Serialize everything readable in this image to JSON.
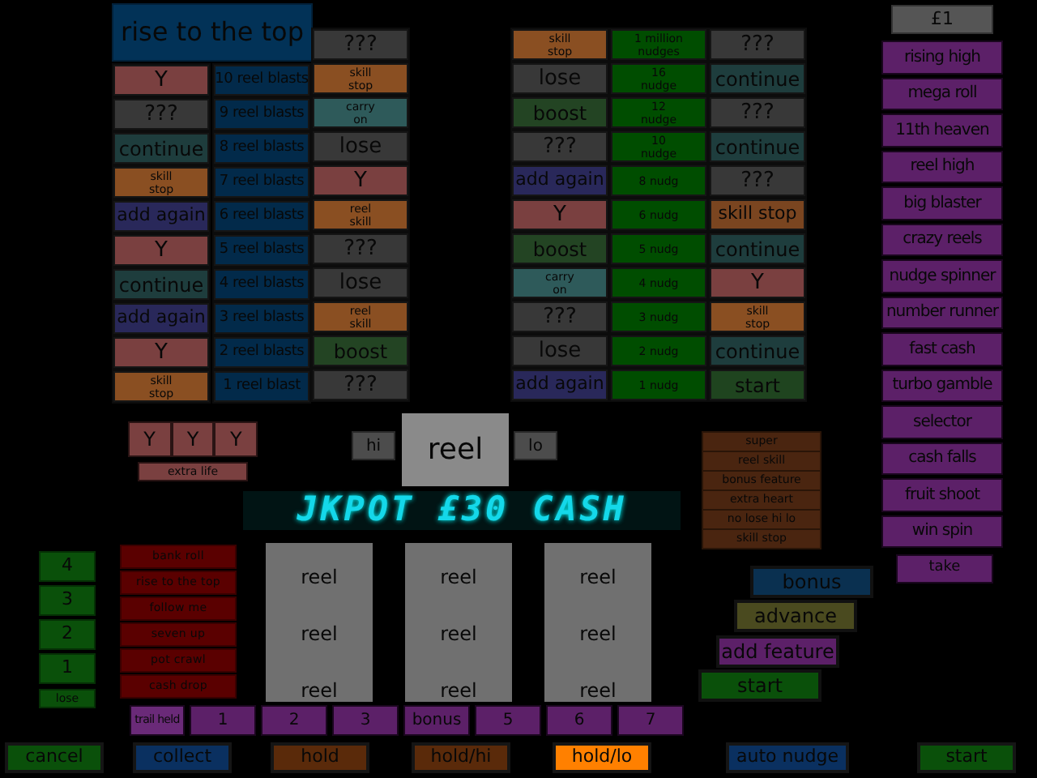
{
  "left_ladder": {
    "title": "rise to the top",
    "col_a": [
      {
        "label": "Y",
        "kind": "y"
      },
      {
        "label": "???",
        "kind": "unknown"
      },
      {
        "label": "continue",
        "kind": "continue"
      },
      {
        "label": "skill stop",
        "kind": "skill"
      },
      {
        "label": "add again",
        "kind": "add"
      },
      {
        "label": "Y",
        "kind": "y"
      },
      {
        "label": "continue",
        "kind": "continue"
      },
      {
        "label": "add again",
        "kind": "add"
      },
      {
        "label": "Y",
        "kind": "y"
      },
      {
        "label": "skill stop",
        "kind": "skill"
      }
    ],
    "col_b": [
      {
        "label": "10 reel blasts",
        "kind": "blast"
      },
      {
        "label": "9 reel blasts",
        "kind": "blast"
      },
      {
        "label": "8 reel blasts",
        "kind": "blast"
      },
      {
        "label": "7 reel blasts",
        "kind": "blast"
      },
      {
        "label": "6 reel blasts",
        "kind": "blast"
      },
      {
        "label": "5 reel blasts",
        "kind": "blast"
      },
      {
        "label": "4 reel blasts",
        "kind": "blast"
      },
      {
        "label": "3 reel blasts",
        "kind": "blast"
      },
      {
        "label": "2 reel blasts",
        "kind": "blast"
      },
      {
        "label": "1 reel blast",
        "kind": "blast"
      }
    ],
    "col_c": [
      {
        "label": "???",
        "kind": "unknown"
      },
      {
        "label": "skill stop",
        "kind": "skill"
      },
      {
        "label": "carry on",
        "kind": "carry"
      },
      {
        "label": "lose",
        "kind": "lose"
      },
      {
        "label": "Y",
        "kind": "y"
      },
      {
        "label": "reel skill",
        "kind": "skill"
      },
      {
        "label": "???",
        "kind": "unknown"
      },
      {
        "label": "lose",
        "kind": "lose"
      },
      {
        "label": "reel skill",
        "kind": "skill"
      },
      {
        "label": "boost",
        "kind": "boost"
      },
      {
        "label": "???",
        "kind": "unknown"
      }
    ]
  },
  "right_ladder": {
    "col_a": [
      {
        "label": "skill stop",
        "kind": "skill"
      },
      {
        "label": "lose",
        "kind": "lose"
      },
      {
        "label": "boost",
        "kind": "boost"
      },
      {
        "label": "???",
        "kind": "unknown"
      },
      {
        "label": "add again",
        "kind": "add"
      },
      {
        "label": "Y",
        "kind": "y"
      },
      {
        "label": "boost",
        "kind": "boost"
      },
      {
        "label": "carry on",
        "kind": "carry"
      },
      {
        "label": "???",
        "kind": "unknown"
      },
      {
        "label": "lose",
        "kind": "lose"
      },
      {
        "label": "add again",
        "kind": "add"
      }
    ],
    "col_b": [
      {
        "label": "1 million nudges",
        "kind": "nudge"
      },
      {
        "label": "16 nudge",
        "kind": "nudge"
      },
      {
        "label": "12 nudge",
        "kind": "nudge"
      },
      {
        "label": "10 nudge",
        "kind": "nudge"
      },
      {
        "label": "8 nudg",
        "kind": "nudge"
      },
      {
        "label": "6 nudg",
        "kind": "nudge"
      },
      {
        "label": "5 nudg",
        "kind": "nudge"
      },
      {
        "label": "4 nudg",
        "kind": "nudge"
      },
      {
        "label": "3 nudg",
        "kind": "nudge"
      },
      {
        "label": "2 nudg",
        "kind": "nudge"
      },
      {
        "label": "1 nudg",
        "kind": "nudge"
      }
    ],
    "col_c": [
      {
        "label": "???",
        "kind": "unknown"
      },
      {
        "label": "continue",
        "kind": "continue"
      },
      {
        "label": "???",
        "kind": "unknown"
      },
      {
        "label": "continue",
        "kind": "continue"
      },
      {
        "label": "???",
        "kind": "unknown"
      },
      {
        "label": "skill stop",
        "kind": "skill_wide"
      },
      {
        "label": "continue",
        "kind": "continue"
      },
      {
        "label": "Y",
        "kind": "y"
      },
      {
        "label": "skill stop",
        "kind": "skill"
      },
      {
        "label": "continue",
        "kind": "continue"
      },
      {
        "label": "start",
        "kind": "start"
      }
    ]
  },
  "stake": "£1",
  "games": [
    "rising high",
    "mega roll",
    "11th heaven",
    "reel high",
    "big blaster",
    "crazy reels",
    "nudge spinner",
    "number runner",
    "fast cash",
    "turbo gamble",
    "selector",
    "cash falls",
    "fruit shoot",
    "win spin"
  ],
  "take": "take",
  "extra_lives": [
    "Y",
    "Y",
    "Y"
  ],
  "extra_life": "extra life",
  "hi": "hi",
  "reel": "reel",
  "lo": "lo",
  "display": "JKPOT £30 CASH",
  "reels": [
    [
      "reel",
      "reel",
      "reel"
    ],
    [
      "reel",
      "reel",
      "reel"
    ],
    [
      "reel",
      "reel",
      "reel"
    ]
  ],
  "cash_trail": [
    "4",
    "3",
    "2",
    "1",
    "lose"
  ],
  "features": [
    "bank roll",
    "rise to the top",
    "follow me",
    "seven up",
    "pot crawl",
    "cash drop"
  ],
  "bonus_list": [
    "super",
    "reel skill",
    "bonus feature",
    "extra heart",
    "no lose hi lo",
    "skill stop"
  ],
  "actions": [
    {
      "label": "bonus",
      "kind": "blue"
    },
    {
      "label": "advance",
      "kind": "olive"
    },
    {
      "label": "add feature",
      "kind": "purple"
    },
    {
      "label": "start",
      "kind": "green"
    }
  ],
  "trail": [
    "trail held",
    "1",
    "2",
    "3",
    "bonus",
    "5",
    "6",
    "7"
  ],
  "buttons": [
    {
      "label": "cancel",
      "kind": "green",
      "lit": false
    },
    {
      "label": "collect",
      "kind": "blue",
      "lit": false
    },
    {
      "label": "hold",
      "kind": "brown",
      "lit": false
    },
    {
      "label": "hold/hi",
      "kind": "brown",
      "lit": false
    },
    {
      "label": "hold/lo",
      "kind": "brown",
      "lit": true
    },
    {
      "label": "auto nudge",
      "kind": "blue",
      "lit": false
    },
    {
      "label": "start",
      "kind": "green",
      "lit": false
    }
  ]
}
